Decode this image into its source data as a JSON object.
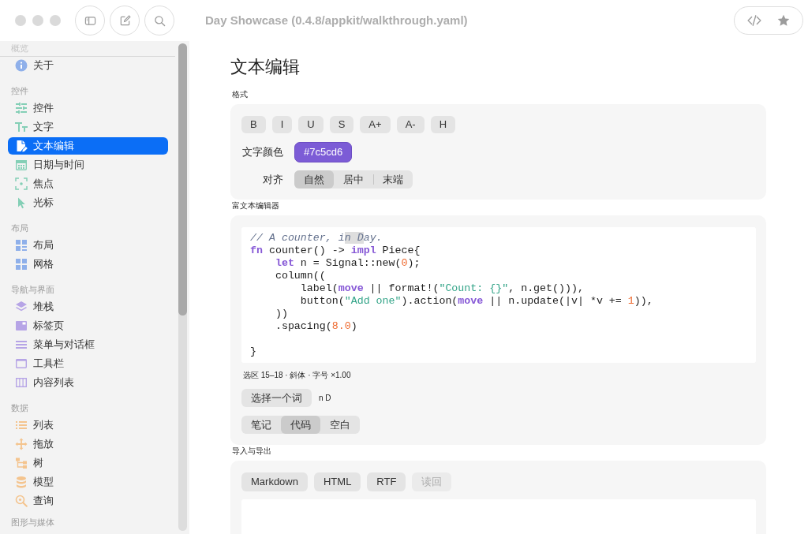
{
  "window": {
    "title": "Day Showcase (0.4.8/appkit/walkthrough.yaml)"
  },
  "sidebar": {
    "sections": [
      {
        "title": "概览",
        "color": "#8fb0ea",
        "items": [
          {
            "label": "关于",
            "selected": false
          }
        ]
      },
      {
        "title": "控件",
        "color": "#84cfb6",
        "items": [
          {
            "label": "控件",
            "selected": false
          },
          {
            "label": "文字",
            "selected": false
          },
          {
            "label": "文本编辑",
            "selected": true
          },
          {
            "label": "日期与时间",
            "selected": false
          },
          {
            "label": "焦点",
            "selected": false
          },
          {
            "label": "光标",
            "selected": false
          }
        ]
      },
      {
        "title": "布局",
        "color": "#8fb0ea",
        "items": [
          {
            "label": "布局",
            "selected": false
          },
          {
            "label": "网格",
            "selected": false
          }
        ]
      },
      {
        "title": "导航与界面",
        "color": "#b6a4e6",
        "items": [
          {
            "label": "堆栈",
            "selected": false
          },
          {
            "label": "标签页",
            "selected": false
          },
          {
            "label": "菜单与对话框",
            "selected": false
          },
          {
            "label": "工具栏",
            "selected": false
          },
          {
            "label": "内容列表",
            "selected": false
          }
        ]
      },
      {
        "title": "数据",
        "color": "#f4c48e",
        "items": [
          {
            "label": "列表",
            "selected": false
          },
          {
            "label": "拖放",
            "selected": false
          },
          {
            "label": "树",
            "selected": false
          },
          {
            "label": "模型",
            "selected": false
          },
          {
            "label": "查询",
            "selected": false
          }
        ]
      },
      {
        "title": "图形与媒体"
      }
    ]
  },
  "page": {
    "title": "文本编辑"
  },
  "format": {
    "label": "格式",
    "style_buttons": [
      "B",
      "I",
      "U",
      "S",
      "A+",
      "A-",
      "H"
    ],
    "color_label": "文字颜色",
    "color_button": {
      "text": "#7c5cd6",
      "color": "#7c5cd6"
    },
    "align_label": "对齐",
    "align_options": [
      {
        "label": "自然",
        "selected": true
      },
      {
        "label": "居中",
        "selected": false
      },
      {
        "label": "末端",
        "selected": false
      }
    ]
  },
  "rich_editor": {
    "label": "富文本编辑器",
    "code": [
      {
        "text": "// A counter, i",
        "kind": "comment"
      },
      {
        "text": "n D",
        "kind": "selection"
      },
      {
        "text": "ay.\n",
        "kind": "comment"
      },
      {
        "text": "fn",
        "kind": "keyword"
      },
      {
        "text": " counter() -> ",
        "kind": "plain"
      },
      {
        "text": "impl",
        "kind": "keyword"
      },
      {
        "text": " Piece{\n    ",
        "kind": "plain"
      },
      {
        "text": "let",
        "kind": "keyword"
      },
      {
        "text": " n = Signal::new(",
        "kind": "plain"
      },
      {
        "text": "0",
        "kind": "number"
      },
      {
        "text": ");\n    column((\n        label(",
        "kind": "plain"
      },
      {
        "text": "move",
        "kind": "keyword"
      },
      {
        "text": " || format!(",
        "kind": "plain"
      },
      {
        "text": "\"Count: {}\"",
        "kind": "string"
      },
      {
        "text": ", n.get())),\n        button(",
        "kind": "plain"
      },
      {
        "text": "\"Add one\"",
        "kind": "string"
      },
      {
        "text": ").action(",
        "kind": "plain"
      },
      {
        "text": "move",
        "kind": "keyword"
      },
      {
        "text": " || n.update(|v| *v += ",
        "kind": "plain"
      },
      {
        "text": "1",
        "kind": "number"
      },
      {
        "text": ")),\n    ))\n    .spacing(",
        "kind": "plain"
      },
      {
        "text": "8.0",
        "kind": "number"
      },
      {
        "text": ")\n\n}",
        "kind": "plain"
      }
    ],
    "status": "选区 15–18 · 斜体 · 字号 ×1.00",
    "select_word_button": "选择一个词",
    "selection_text": "n D",
    "modes": [
      {
        "label": "笔记",
        "selected": false
      },
      {
        "label": "代码",
        "selected": true
      },
      {
        "label": "空白",
        "selected": false
      }
    ]
  },
  "export": {
    "label": "导入与导出",
    "buttons": [
      {
        "label": "Markdown",
        "disabled": false
      },
      {
        "label": "HTML",
        "disabled": false
      },
      {
        "label": "RTF",
        "disabled": false
      },
      {
        "label": "读回",
        "disabled": true
      }
    ]
  }
}
